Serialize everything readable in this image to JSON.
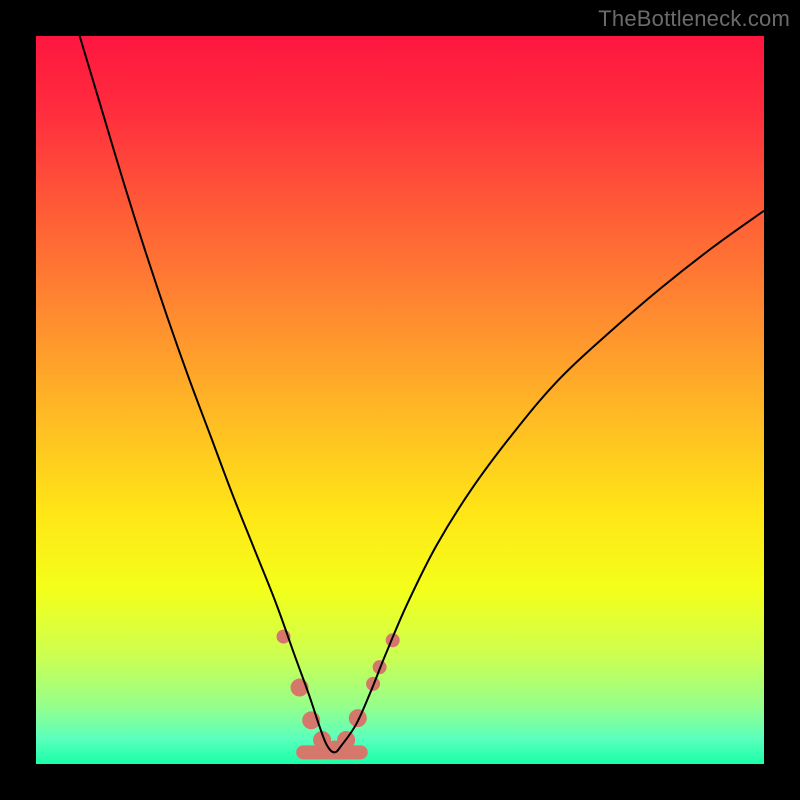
{
  "watermark": "TheBottleneck.com",
  "chart_data": {
    "type": "line",
    "title": "",
    "xlabel": "",
    "ylabel": "",
    "xlim": [
      0,
      100
    ],
    "ylim": [
      0,
      100
    ],
    "grid": false,
    "legend": "none",
    "annotations": [],
    "background_gradient": {
      "stops": [
        {
          "offset": 0.0,
          "color": "#ff163f"
        },
        {
          "offset": 0.1,
          "color": "#ff2c3e"
        },
        {
          "offset": 0.22,
          "color": "#ff5538"
        },
        {
          "offset": 0.38,
          "color": "#ff8a30"
        },
        {
          "offset": 0.53,
          "color": "#ffbd24"
        },
        {
          "offset": 0.66,
          "color": "#ffe716"
        },
        {
          "offset": 0.76,
          "color": "#f4ff1a"
        },
        {
          "offset": 0.85,
          "color": "#cdff50"
        },
        {
          "offset": 0.92,
          "color": "#96ff8a"
        },
        {
          "offset": 0.965,
          "color": "#5bffbd"
        },
        {
          "offset": 1.0,
          "color": "#19ffa8"
        }
      ]
    },
    "series": [
      {
        "name": "bottleneck-curve",
        "color": "#000000",
        "width": 2.0,
        "x": [
          6.0,
          9.0,
          12.0,
          15.0,
          18.0,
          21.0,
          24.0,
          27.0,
          30.0,
          33.0,
          35.5,
          37.5,
          39.0,
          40.0,
          41.0,
          42.0,
          44.0,
          46.0,
          48.0,
          51.0,
          55.0,
          60.0,
          66.0,
          72.0,
          79.0,
          86.0,
          93.0,
          100.0
        ],
        "y": [
          100.0,
          90.0,
          80.0,
          70.5,
          61.5,
          53.0,
          45.0,
          37.0,
          29.5,
          22.0,
          15.0,
          9.5,
          5.0,
          2.5,
          1.6,
          2.6,
          5.5,
          10.0,
          15.0,
          22.0,
          30.0,
          38.0,
          46.0,
          53.0,
          59.5,
          65.5,
          71.0,
          76.0
        ]
      }
    ],
    "markers": {
      "color": "#d6776c",
      "radius_small": 7,
      "radius_large": 9,
      "points": [
        {
          "x": 34.0,
          "y": 17.5,
          "r": "small"
        },
        {
          "x": 36.2,
          "y": 10.5,
          "r": "large"
        },
        {
          "x": 37.8,
          "y": 6.0,
          "r": "large"
        },
        {
          "x": 39.3,
          "y": 3.3,
          "r": "large"
        },
        {
          "x": 41.0,
          "y": 2.0,
          "r": "large"
        },
        {
          "x": 42.6,
          "y": 3.3,
          "r": "large"
        },
        {
          "x": 44.2,
          "y": 6.3,
          "r": "large"
        },
        {
          "x": 46.3,
          "y": 11.0,
          "r": "small"
        },
        {
          "x": 47.2,
          "y": 13.3,
          "r": "small"
        },
        {
          "x": 49.0,
          "y": 17.0,
          "r": "small"
        }
      ],
      "bottom_bar": {
        "x1": 36.7,
        "x2": 44.6,
        "y": 1.6,
        "thickness": 14
      }
    }
  }
}
